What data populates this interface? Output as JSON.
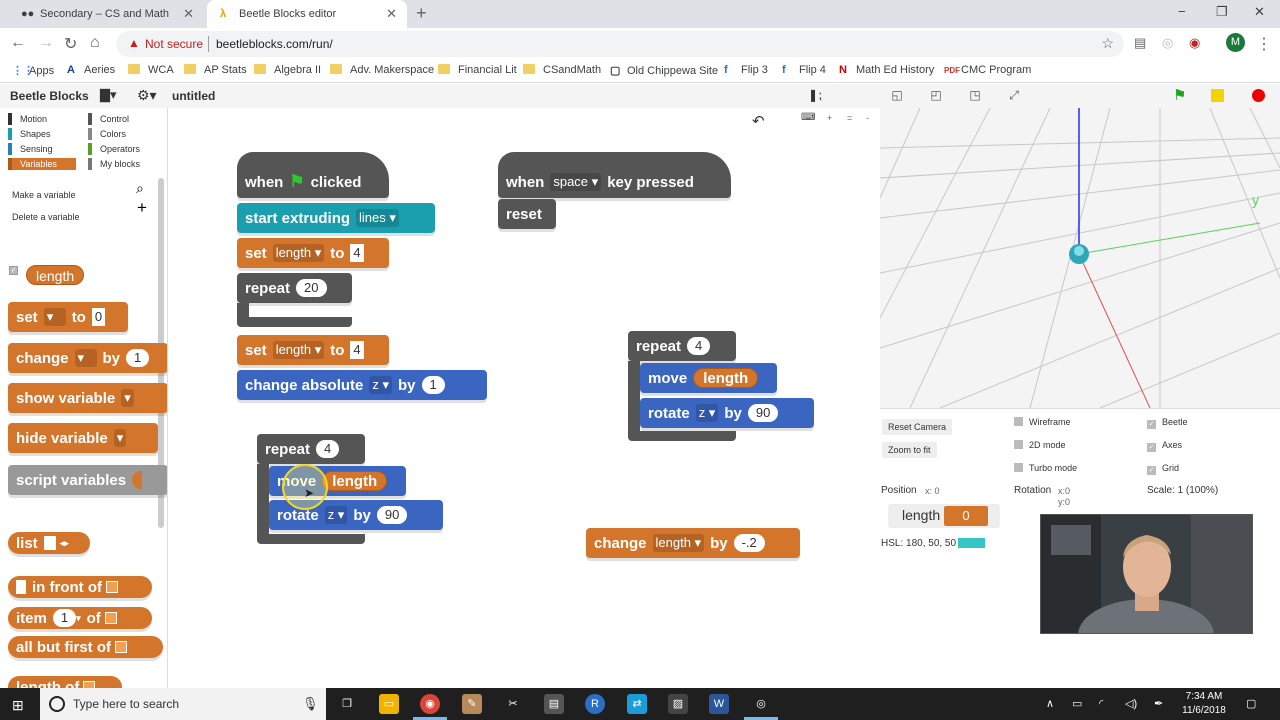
{
  "browser": {
    "tabs": [
      {
        "title": "Secondary – CS and Math",
        "icon": "classroom-icon"
      },
      {
        "title": "Beetle Blocks editor",
        "icon": "lambda-icon",
        "active": true
      }
    ],
    "new_tab_icon": "+",
    "window_controls": [
      "−",
      "❐",
      "✕"
    ],
    "security_label": "Not secure",
    "url": "beetleblocks.com/run/",
    "profile_initial": "M",
    "bookmarks": [
      {
        "label": "Apps",
        "icon": "apps-grid-icon"
      },
      {
        "label": "Aeries",
        "icon": "aeries-icon"
      },
      {
        "label": "WCA",
        "icon": "folder-icon"
      },
      {
        "label": "AP Stats",
        "icon": "folder-icon"
      },
      {
        "label": "Algebra II",
        "icon": "folder-icon"
      },
      {
        "label": "Adv. Makerspace",
        "icon": "folder-icon"
      },
      {
        "label": "Financial Lit",
        "icon": "folder-icon"
      },
      {
        "label": "CSandMath",
        "icon": "folder-icon"
      },
      {
        "label": "Old Chippewa Site",
        "icon": "page-icon"
      },
      {
        "label": "Flip 3",
        "icon": "flip-icon"
      },
      {
        "label": "Flip 4",
        "icon": "flip-icon"
      },
      {
        "label": "Math Ed History",
        "icon": "netflix-n-icon"
      },
      {
        "label": "CMC Program",
        "icon": "pdf-icon"
      }
    ]
  },
  "app": {
    "logo": "Beetle Blocks",
    "project_name": "untitled",
    "categories": [
      {
        "label": "Motion",
        "color": "#3a66c2"
      },
      {
        "label": "Control",
        "color": "#555555"
      },
      {
        "label": "Shapes",
        "color": "#1b9fae"
      },
      {
        "label": "Colors",
        "color": "#888888"
      },
      {
        "label": "Sensing",
        "color": "#2a7fb8"
      },
      {
        "label": "Operators",
        "color": "#5a9e2a"
      },
      {
        "label": "Variables",
        "color": "#d4752c",
        "active": true
      },
      {
        "label": "My blocks",
        "color": "#777777"
      }
    ],
    "make_variable": "Make a variable",
    "delete_variable": "Delete a variable",
    "palette": {
      "var_length": "length",
      "set": {
        "a": "set",
        "b": "to",
        "v": "0"
      },
      "change": {
        "a": "change",
        "b": "by",
        "v": "1"
      },
      "show_variable": "show variable",
      "hide_variable": "hide variable",
      "script_variables": "script variables",
      "list": "list",
      "in_front_of": "in front of",
      "item": {
        "a": "item",
        "v": "1",
        "b": "of"
      },
      "all_but_first": "all but first of",
      "length_of": "length of"
    },
    "scripts": {
      "s1": {
        "when": "when",
        "clicked": "clicked",
        "start_extruding": "start extruding",
        "lines": "lines",
        "set1": {
          "a": "set",
          "var": "length",
          "b": "to",
          "v": "4"
        },
        "repeat": {
          "a": "repeat",
          "v": "20"
        },
        "set2": {
          "a": "set",
          "var": "length",
          "b": "to",
          "v": "4"
        },
        "change_abs": {
          "a": "change absolute",
          "axis": "z",
          "b": "by",
          "v": "1"
        }
      },
      "s2": {
        "when": "when",
        "key": "space",
        "pressed": "key pressed",
        "reset": "reset"
      },
      "s3": {
        "repeat": {
          "a": "repeat",
          "v": "4"
        },
        "move": {
          "a": "move",
          "var": "length"
        },
        "rotate": {
          "a": "rotate",
          "axis": "z",
          "b": "by",
          "v": "90"
        }
      },
      "s4": {
        "repeat": {
          "a": "repeat",
          "v": "4"
        },
        "move": {
          "a": "move",
          "var": "length"
        },
        "rotate": {
          "a": "rotate",
          "axis": "z",
          "b": "by",
          "v": "90"
        }
      },
      "s5": {
        "a": "change",
        "var": "length",
        "b": "by",
        "v": "-.2"
      }
    },
    "stage": {
      "axis_label": "y",
      "reset_camera": "Reset Camera",
      "zoom_to_fit": "Zoom to fit",
      "options": [
        {
          "label": "Wireframe",
          "checked": false
        },
        {
          "label": "Beetle",
          "checked": true
        },
        {
          "label": "2D mode",
          "checked": false
        },
        {
          "label": "Axes",
          "checked": true
        },
        {
          "label": "Turbo mode",
          "checked": false
        },
        {
          "label": "Grid",
          "checked": true
        }
      ],
      "position_label": "Position",
      "position_x": "x: 0",
      "rotation_label": "Rotation",
      "rotation_x": "x:0",
      "rotation_y": "y:0",
      "scale": "Scale: 1 (100%)",
      "watcher_label": "length",
      "watcher_value": "0",
      "hsl": "HSL: 180, 50, 50",
      "hsl_color": "#36c4c4"
    }
  },
  "taskbar": {
    "search_placeholder": "Type here to search",
    "time": "7:34 AM",
    "date": "11/6/2018"
  }
}
